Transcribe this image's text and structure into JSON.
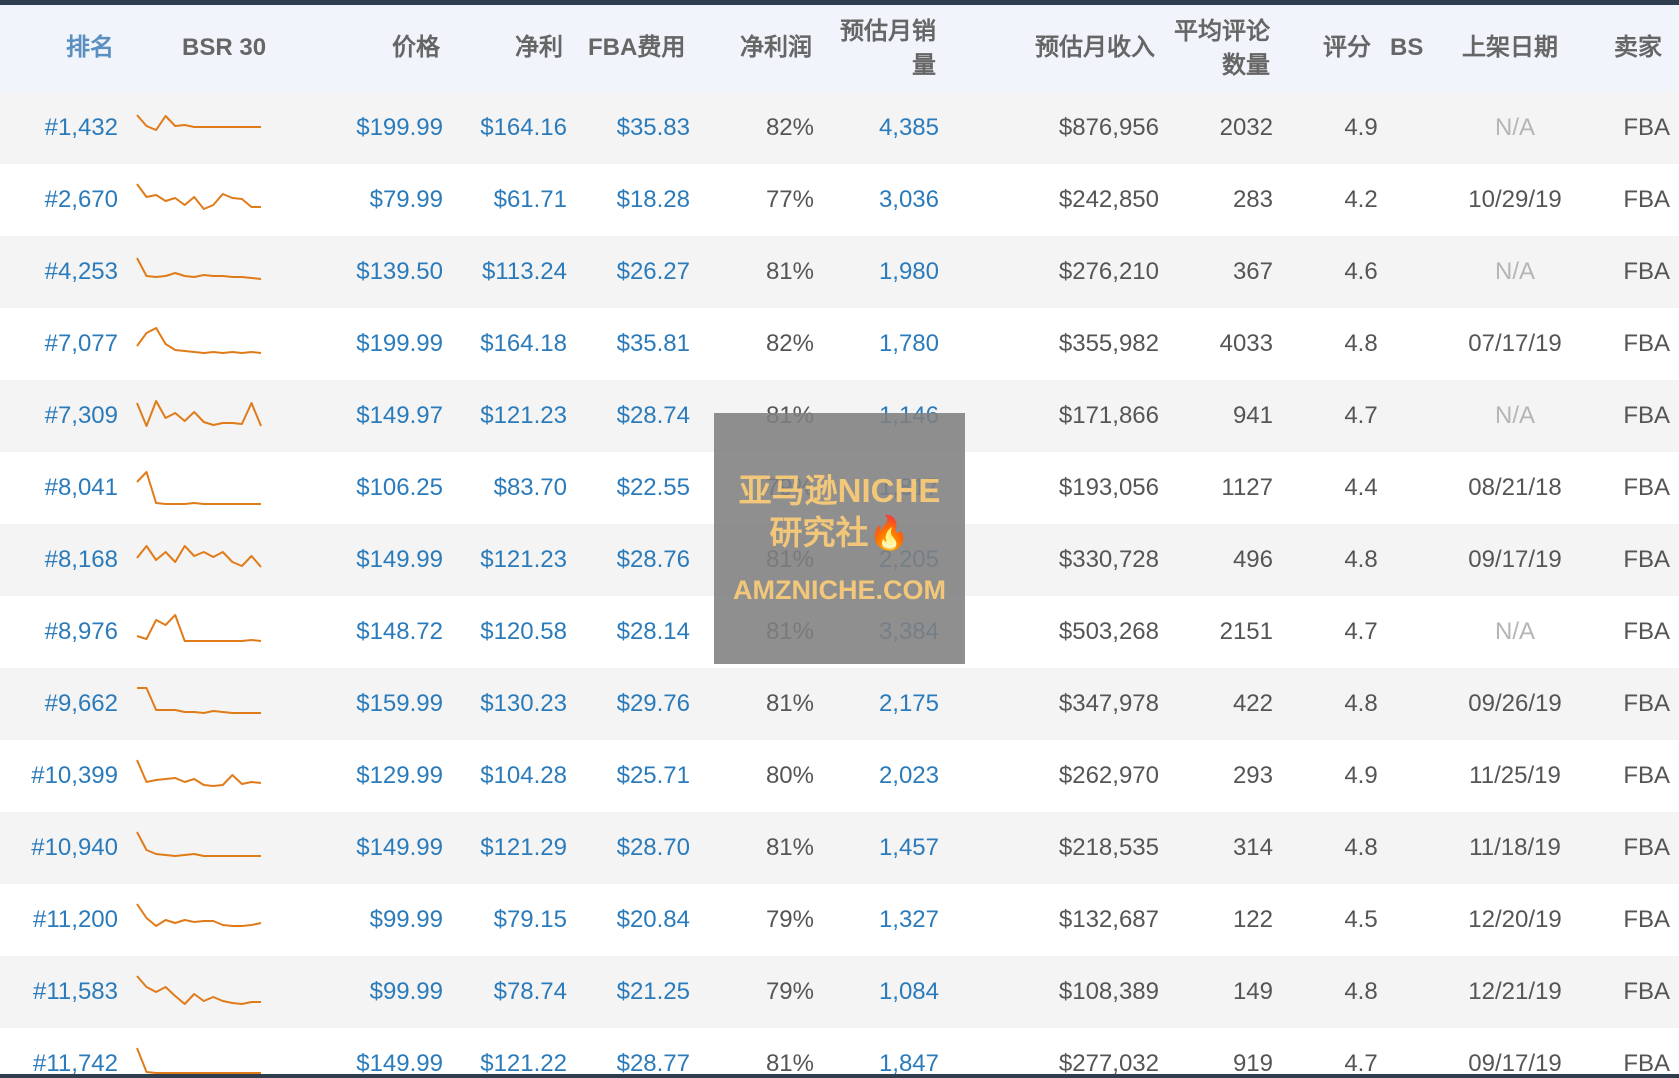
{
  "headers": {
    "rank": "排名",
    "bsr": "BSR 30",
    "price": "价格",
    "net": "净利",
    "fba": "FBA费用",
    "margin": "净利润",
    "sales_l1": "预估月销",
    "sales_l2": "量",
    "revenue": "预估月收入",
    "reviews_l1": "平均评论",
    "reviews_l2": "数量",
    "rating": "评分",
    "bs": "BS",
    "date": "上架日期",
    "seller": "卖家"
  },
  "rows": [
    {
      "rank": "#1,432",
      "price": "$199.99",
      "net": "$164.16",
      "fba": "$35.83",
      "margin": "82%",
      "sales": "4,385",
      "revenue": "$876,956",
      "reviews": "2032",
      "rating": "4.9",
      "date": "N/A",
      "seller": "FBA",
      "spark": [
        5,
        16,
        20,
        6,
        16,
        15,
        17,
        17,
        17,
        17,
        17,
        17,
        17,
        17
      ]
    },
    {
      "rank": "#2,670",
      "price": "$79.99",
      "net": "$61.71",
      "fba": "$18.28",
      "margin": "77%",
      "sales": "3,036",
      "revenue": "$242,850",
      "reviews": "283",
      "rating": "4.2",
      "date": "10/29/19",
      "seller": "FBA",
      "spark": [
        2,
        15,
        13,
        19,
        16,
        23,
        15,
        27,
        23,
        12,
        16,
        17,
        25,
        25
      ]
    },
    {
      "rank": "#4,253",
      "price": "$139.50",
      "net": "$113.24",
      "fba": "$26.27",
      "margin": "81%",
      "sales": "1,980",
      "revenue": "$276,210",
      "reviews": "367",
      "rating": "4.6",
      "date": "N/A",
      "seller": "FBA",
      "spark": [
        4,
        22,
        23,
        22,
        19,
        22,
        23,
        21,
        22,
        22,
        23,
        23,
        24,
        25
      ]
    },
    {
      "rank": "#7,077",
      "price": "$199.99",
      "net": "$164.18",
      "fba": "$35.81",
      "margin": "82%",
      "sales": "1,780",
      "revenue": "$355,982",
      "reviews": "4033",
      "rating": "4.8",
      "date": "07/17/19",
      "seller": "FBA",
      "spark": [
        20,
        7,
        2,
        18,
        24,
        25,
        26,
        27,
        26,
        27,
        26,
        27,
        26,
        27
      ]
    },
    {
      "rank": "#7,309",
      "price": "$149.97",
      "net": "$121.23",
      "fba": "$28.74",
      "margin": "81%",
      "sales": "1,146",
      "revenue": "$171,866",
      "reviews": "941",
      "rating": "4.7",
      "date": "N/A",
      "seller": "FBA",
      "spark": [
        5,
        28,
        3,
        20,
        15,
        23,
        14,
        24,
        27,
        25,
        25,
        26,
        5,
        28
      ]
    },
    {
      "rank": "#8,041",
      "price": "$106.25",
      "net": "$83.70",
      "fba": "$22.55",
      "margin": "79%",
      "sales": "1,817",
      "revenue": "$193,056",
      "reviews": "1127",
      "rating": "4.4",
      "date": "08/21/18",
      "seller": "FBA",
      "spark": [
        12,
        2,
        33,
        34,
        34,
        34,
        33,
        34,
        34,
        34,
        34,
        34,
        34,
        34
      ]
    },
    {
      "rank": "#8,168",
      "price": "$149.99",
      "net": "$121.23",
      "fba": "$28.76",
      "margin": "81%",
      "sales": "2,205",
      "revenue": "$330,728",
      "reviews": "496",
      "rating": "4.8",
      "date": "09/17/19",
      "seller": "FBA",
      "spark": [
        16,
        4,
        18,
        10,
        20,
        4,
        14,
        10,
        15,
        10,
        20,
        24,
        14,
        25
      ]
    },
    {
      "rank": "#8,976",
      "price": "$148.72",
      "net": "$120.58",
      "fba": "$28.14",
      "margin": "81%",
      "sales": "3,384",
      "revenue": "$503,268",
      "reviews": "2151",
      "rating": "4.7",
      "date": "N/A",
      "seller": "FBA",
      "spark": [
        22,
        25,
        6,
        11,
        1,
        27,
        27,
        27,
        27,
        27,
        27,
        27,
        26,
        27
      ]
    },
    {
      "rank": "#9,662",
      "price": "$159.99",
      "net": "$130.23",
      "fba": "$29.76",
      "margin": "81%",
      "sales": "2,175",
      "revenue": "$347,978",
      "reviews": "422",
      "rating": "4.8",
      "date": "09/26/19",
      "seller": "FBA",
      "spark": [
        2,
        2,
        24,
        24,
        24,
        26,
        26,
        27,
        25,
        26,
        27,
        27,
        27,
        27
      ]
    },
    {
      "rank": "#10,399",
      "price": "$129.99",
      "net": "$104.28",
      "fba": "$25.71",
      "margin": "80%",
      "sales": "2,023",
      "revenue": "$262,970",
      "reviews": "293",
      "rating": "4.9",
      "date": "11/25/19",
      "seller": "FBA",
      "spark": [
        2,
        24,
        22,
        21,
        20,
        24,
        21,
        27,
        28,
        27,
        17,
        26,
        24,
        25
      ]
    },
    {
      "rank": "#10,940",
      "price": "$149.99",
      "net": "$121.29",
      "fba": "$28.70",
      "margin": "81%",
      "sales": "1,457",
      "revenue": "$218,535",
      "reviews": "314",
      "rating": "4.8",
      "date": "11/18/19",
      "seller": "FBA",
      "spark": [
        2,
        20,
        24,
        25,
        26,
        25,
        24,
        26,
        26,
        26,
        26,
        26,
        26,
        26
      ]
    },
    {
      "rank": "#11,200",
      "price": "$99.99",
      "net": "$79.15",
      "fba": "$20.84",
      "margin": "79%",
      "sales": "1,327",
      "revenue": "$132,687",
      "reviews": "122",
      "rating": "4.5",
      "date": "12/20/19",
      "seller": "FBA",
      "spark": [
        2,
        16,
        24,
        18,
        21,
        18,
        20,
        19,
        19,
        23,
        24,
        24,
        23,
        21
      ]
    },
    {
      "rank": "#11,583",
      "price": "$99.99",
      "net": "$78.74",
      "fba": "$21.25",
      "margin": "79%",
      "sales": "1,084",
      "revenue": "$108,389",
      "reviews": "149",
      "rating": "4.8",
      "date": "12/21/19",
      "seller": "FBA",
      "spark": [
        2,
        13,
        18,
        13,
        22,
        30,
        20,
        27,
        23,
        27,
        29,
        30,
        28,
        28
      ]
    },
    {
      "rank": "#11,742",
      "price": "$149.99",
      "net": "$121.22",
      "fba": "$28.77",
      "margin": "81%",
      "sales": "1,847",
      "revenue": "$277,032",
      "reviews": "919",
      "rating": "4.7",
      "date": "09/17/19",
      "seller": "FBA",
      "spark": [
        2,
        26,
        27,
        27,
        27,
        27,
        27,
        27,
        27,
        27,
        27,
        27,
        27,
        27
      ]
    }
  ],
  "watermark": {
    "line1": "亚马逊NICHE",
    "line2": "研究社🔥",
    "line3": "AMZNICHE.COM"
  },
  "colors": {
    "spark": "#e07b1a",
    "link": "#2b7bbb",
    "muted": "#b5b5b5",
    "header_bg": "#f1f5fb"
  }
}
